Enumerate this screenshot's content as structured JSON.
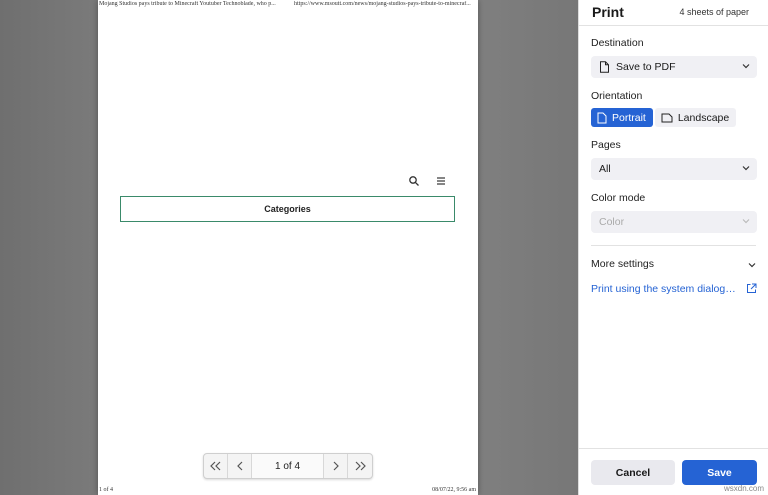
{
  "preview": {
    "header_left": "Mojang Studios pays tribute to Minecraft Youtuber Technoblade, who p...",
    "header_right": "https://www.msoutt.com/news/mojang-studios-pays-tribute-to-minecraf...",
    "footer_left": "1 of 4",
    "footer_right": "08/07/22, 9:56 am",
    "categories_label": "Categories",
    "page_counter": "1 of 4"
  },
  "sidebar": {
    "title": "Print",
    "sheets": "4 sheets of paper",
    "destination": {
      "label": "Destination",
      "value": "Save to PDF"
    },
    "orientation": {
      "label": "Orientation",
      "portrait": "Portrait",
      "landscape": "Landscape",
      "selected": "Portrait"
    },
    "pages": {
      "label": "Pages",
      "value": "All"
    },
    "color_mode": {
      "label": "Color mode",
      "value": "Color"
    },
    "more_settings": "More settings",
    "system_dialog_link": "Print using the system dialog…",
    "cancel_label": "Cancel",
    "save_label": "Save"
  },
  "watermark": "wsxdn.com",
  "colors": {
    "accent": "#2563d4",
    "categories_border": "#3a8a6a"
  }
}
